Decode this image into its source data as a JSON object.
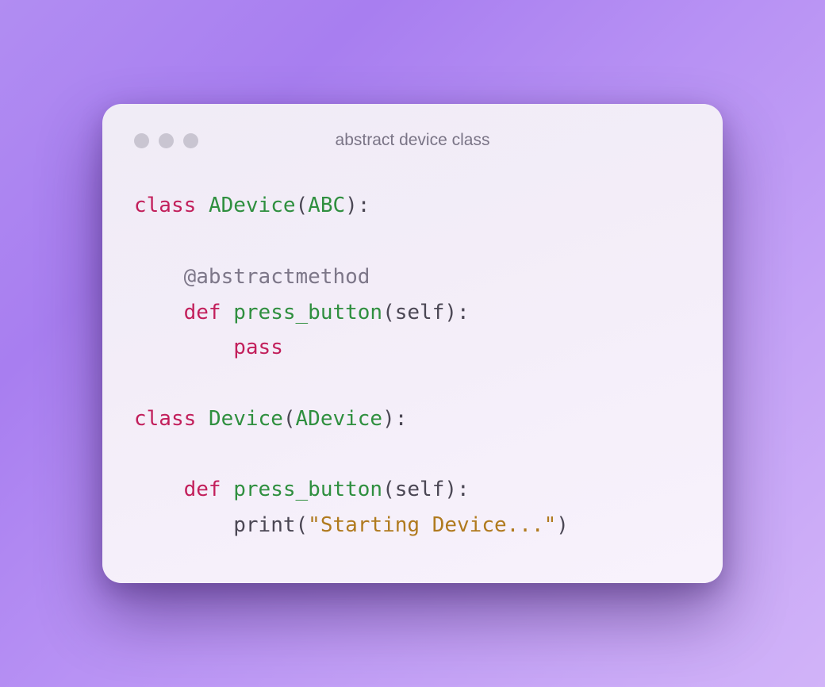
{
  "window": {
    "title": "abstract device class"
  },
  "code": {
    "kw_class": "class",
    "kw_def": "def",
    "kw_pass": "pass",
    "space": " ",
    "indent1": "    ",
    "indent2": "        ",
    "lparen": "(",
    "rparen": ")",
    "colon": ":",
    "adevice_name": "ADevice",
    "abc_name": "ABC",
    "decorator": "@abstractmethod",
    "press_button": "press_button",
    "self": "self",
    "device_name": "Device",
    "adevice_base": "ADevice",
    "print_call": "print",
    "string_lit": "\"Starting Device...\""
  }
}
